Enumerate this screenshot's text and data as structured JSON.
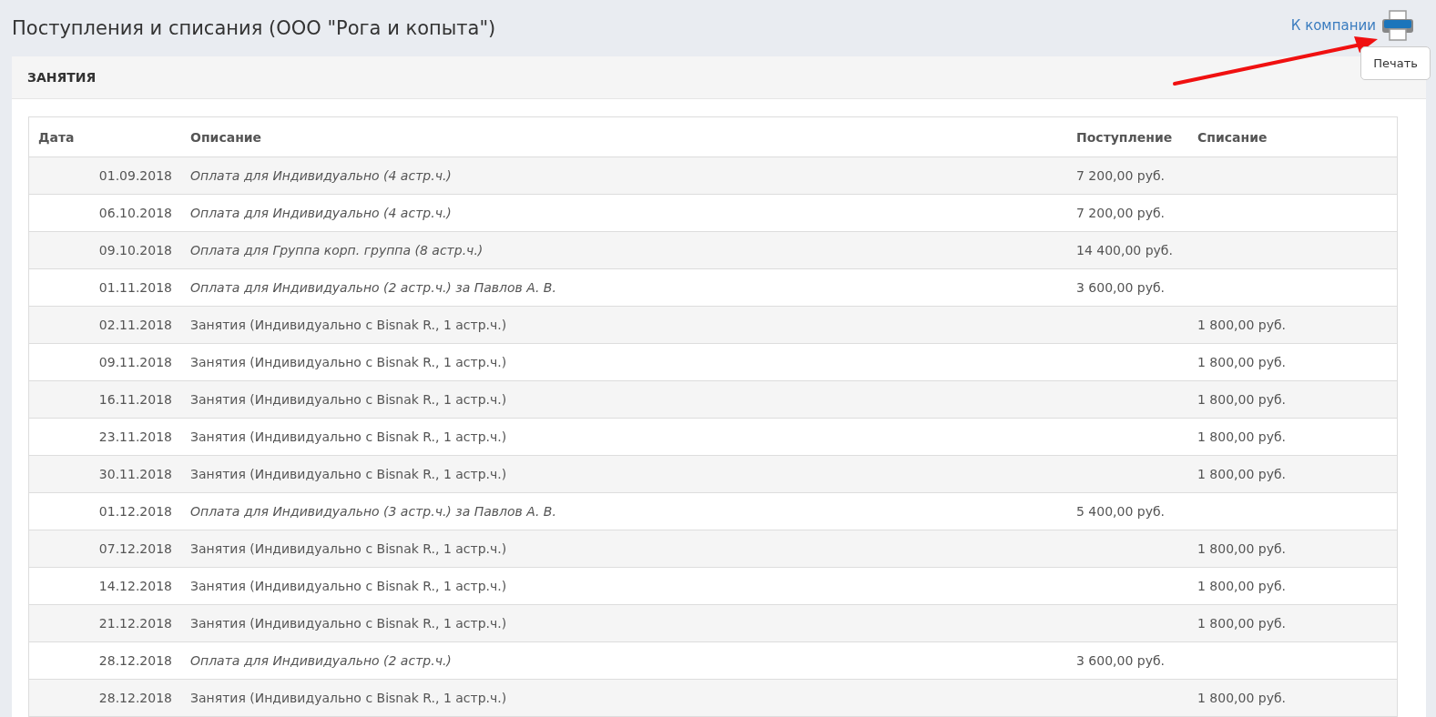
{
  "page_title": "Поступления и списания (ООО \"Рога и копыта\")",
  "back_link": "К компании",
  "print_tooltip": "Печать",
  "section_title": "ЗАНЯТИЯ",
  "table": {
    "columns": [
      "Дата",
      "Описание",
      "Поступление",
      "Списание"
    ],
    "rows": [
      {
        "kind": "payment",
        "date": "01.09.2018",
        "description": "Оплата для Индивидуально (4 астр.ч.)",
        "income": "7 200,00 руб.",
        "expense": ""
      },
      {
        "kind": "payment",
        "date": "06.10.2018",
        "description": "Оплата для Индивидуально (4 астр.ч.)",
        "income": "7 200,00 руб.",
        "expense": ""
      },
      {
        "kind": "payment",
        "date": "09.10.2018",
        "description": "Оплата для Группа корп. группа (8 астр.ч.)",
        "income": "14 400,00 руб.",
        "expense": ""
      },
      {
        "kind": "payment",
        "date": "01.11.2018",
        "description": "Оплата для Индивидуально (2 астр.ч.) за Павлов А. В.",
        "income": "3 600,00 руб.",
        "expense": ""
      },
      {
        "kind": "lesson",
        "date": "02.11.2018",
        "description": "Занятия (Индивидуально с Bisnak R., 1 астр.ч.)",
        "income": "",
        "expense": "1 800,00 руб."
      },
      {
        "kind": "lesson",
        "date": "09.11.2018",
        "description": "Занятия (Индивидуально с Bisnak R., 1 астр.ч.)",
        "income": "",
        "expense": "1 800,00 руб."
      },
      {
        "kind": "lesson",
        "date": "16.11.2018",
        "description": "Занятия (Индивидуально с Bisnak R., 1 астр.ч.)",
        "income": "",
        "expense": "1 800,00 руб."
      },
      {
        "kind": "lesson",
        "date": "23.11.2018",
        "description": "Занятия (Индивидуально с Bisnak R., 1 астр.ч.)",
        "income": "",
        "expense": "1 800,00 руб."
      },
      {
        "kind": "lesson",
        "date": "30.11.2018",
        "description": "Занятия (Индивидуально с Bisnak R., 1 астр.ч.)",
        "income": "",
        "expense": "1 800,00 руб."
      },
      {
        "kind": "payment",
        "date": "01.12.2018",
        "description": "Оплата для Индивидуально (3 астр.ч.) за Павлов А. В.",
        "income": "5 400,00 руб.",
        "expense": ""
      },
      {
        "kind": "lesson",
        "date": "07.12.2018",
        "description": "Занятия (Индивидуально с Bisnak R., 1 астр.ч.)",
        "income": "",
        "expense": "1 800,00 руб."
      },
      {
        "kind": "lesson",
        "date": "14.12.2018",
        "description": "Занятия (Индивидуально с Bisnak R., 1 астр.ч.)",
        "income": "",
        "expense": "1 800,00 руб."
      },
      {
        "kind": "lesson",
        "date": "21.12.2018",
        "description": "Занятия (Индивидуально с Bisnak R., 1 астр.ч.)",
        "income": "",
        "expense": "1 800,00 руб."
      },
      {
        "kind": "payment",
        "date": "28.12.2018",
        "description": "Оплата для Индивидуально (2 астр.ч.)",
        "income": "3 600,00 руб.",
        "expense": ""
      },
      {
        "kind": "lesson",
        "date": "28.12.2018",
        "description": "Занятия (Индивидуально с Bisnak R., 1 астр.ч.)",
        "income": "",
        "expense": "1 800,00 руб."
      }
    ]
  }
}
